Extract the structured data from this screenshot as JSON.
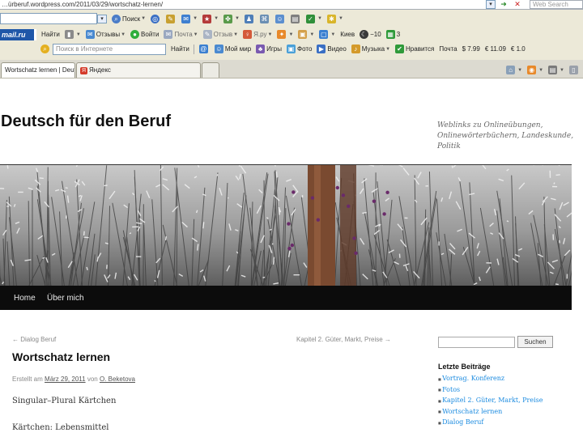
{
  "browser": {
    "url": "…ürberuf.wordpress.com/2011/03/29/wortschatz-lernen/",
    "web_search_placeholder": "Web Search",
    "toolbar1": {
      "search_label": "Поиск"
    },
    "toolbar2": {
      "brand": "mail.ru",
      "find_label": "Найти",
      "reviews_label": "Отзывы",
      "login_label": "Войти",
      "mail_label": "Почта",
      "notes_label": "Отзыв",
      "yaru_label": "Я.ру",
      "city": "Киев",
      "temperature": "−10",
      "count": "3"
    },
    "toolbar3": {
      "search_placeholder": "Поиск в Интернете",
      "find_label": "Найти",
      "my_world_label": "Мой мир",
      "games_label": "Игры",
      "photo_label": "Фото",
      "video_label": "Видео",
      "music_label": "Музыка",
      "likes_label": "Нравится",
      "mail_label": "Почта",
      "price_usd": "$ 7.99",
      "price_eur": "€ 11.09",
      "price_partial": "€ 1.0"
    },
    "tabs": [
      {
        "label": "Wortschatz lernen | Deut…"
      },
      {
        "label": "Яндекс"
      }
    ]
  },
  "site": {
    "title": "Deutsch für den Beruf",
    "description": "Weblinks zu Onlineübungen, Onlinewörterbüchern, Landeskunde, Politik"
  },
  "nav": {
    "items": [
      "Home",
      "Über mich"
    ]
  },
  "post_nav": {
    "previous": "← Dialog Beruf",
    "next": "Kapitel 2. Güter, Markt, Preise →"
  },
  "post": {
    "title": "Wortschatz lernen",
    "meta_prefix": "Erstellt am",
    "date": "März 29, 2011",
    "meta_by": "von",
    "author": "O. Beketova",
    "lines": [
      "Singular–Plural Kärtchen",
      "Kärtchen: Lebensmittel"
    ]
  },
  "sidebar": {
    "search_button": "Suchen",
    "recent_title": "Letzte Beiträge",
    "recent_posts": [
      "Vortrag. Konferenz",
      "Fotos",
      "Kapitel 2. Güter, Markt, Preise",
      "Wortschatz lernen",
      "Dialog Beruf"
    ]
  }
}
